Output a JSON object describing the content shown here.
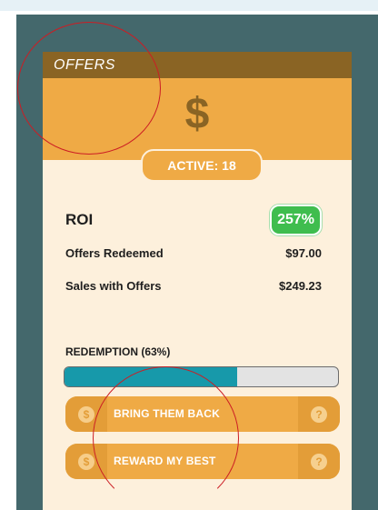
{
  "card": {
    "title": "OFFERS",
    "hero_symbol": "$",
    "active_label": "ACTIVE: 18"
  },
  "metrics": {
    "roi_label": "ROI",
    "roi_value": "257%",
    "offers_redeemed_label": "Offers Redeemed",
    "offers_redeemed_value": "$97.00",
    "sales_with_offers_label": "Sales with Offers",
    "sales_with_offers_value": "$249.23"
  },
  "redemption": {
    "label": "REDEMPTION (63%)",
    "percent": 63
  },
  "actions": [
    {
      "label": "BRING THEM BACK",
      "left_icon": "dollar-coin-icon",
      "right_icon": "help-icon"
    },
    {
      "label": "REWARD MY BEST",
      "left_icon": "dollar-coin-icon",
      "right_icon": "help-icon"
    }
  ],
  "icons": {
    "coin_glyph": "$",
    "help_glyph": "?"
  },
  "colors": {
    "frame": "#44686c",
    "card_background": "#fdf0dc",
    "header": "#8a6424",
    "hero": "#efaa45",
    "roi_badge": "#3fbd4e",
    "progress_fill": "#1799aa",
    "annotation": "#cc1d24"
  }
}
